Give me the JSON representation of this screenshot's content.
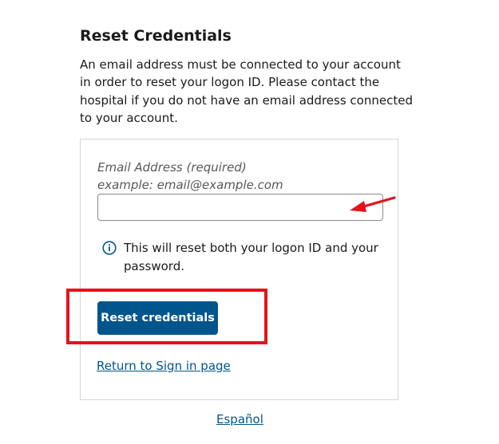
{
  "header": {
    "title": "Reset Credentials",
    "intro": "An email address must be connected to your account in order to reset your logon ID. Please contact the hospital if you do not have an email address connected to your account."
  },
  "form": {
    "email_label": "Email Address (required)",
    "email_hint": "example: email@example.com",
    "email_value": "",
    "email_placeholder": "",
    "info_icon": "info-circle-icon",
    "info_text": "This will reset both your logon ID and your password.",
    "submit_label": "Reset credentials",
    "return_link": "Return to Sign in page"
  },
  "footer": {
    "language_link": "Español"
  },
  "annotations": {
    "arrow_icon": "red-arrow-icon",
    "highlight_color": "#e8111b"
  },
  "colors": {
    "primary": "#00558c",
    "annotation": "#e8111b",
    "card_border": "#d6d6d6",
    "hint_text": "#595959"
  }
}
